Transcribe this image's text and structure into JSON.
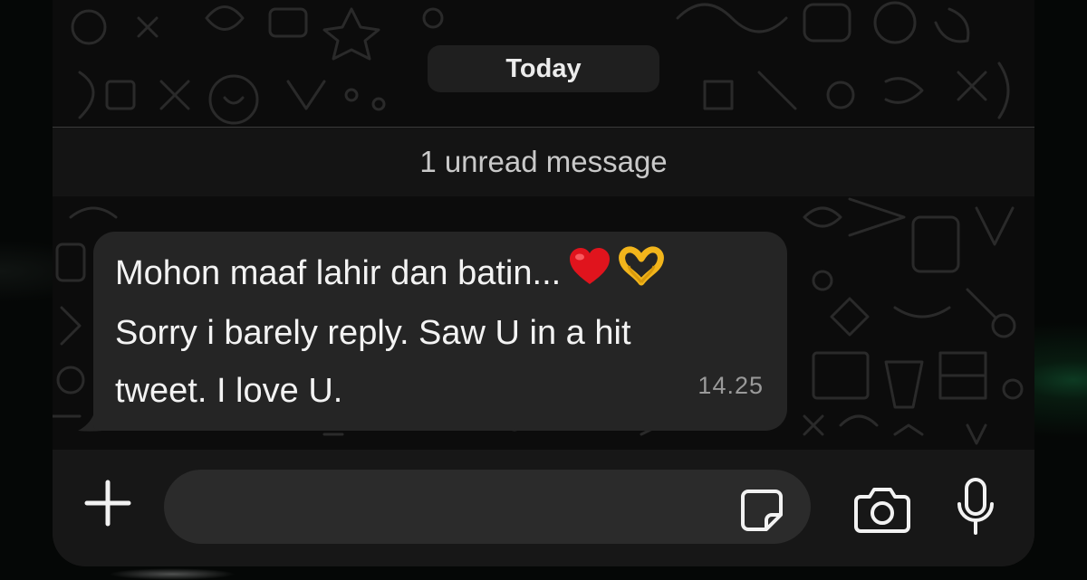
{
  "chat": {
    "date_separator": "Today",
    "unread_banner": "1 unread message",
    "messages": [
      {
        "lines": [
          "Mohon maaf lahir dan batin...",
          "Sorry i barely reply. Saw U in a hit",
          "tweet. I love U."
        ],
        "emojis": [
          "heart-emoji",
          "heart-hands-emoji"
        ],
        "time": "14.25",
        "direction": "incoming"
      }
    ]
  },
  "composer": {
    "value": "",
    "icons": {
      "attach": "plus-icon",
      "sticker": "sticker-icon",
      "camera": "camera-icon",
      "voice": "microphone-icon"
    }
  },
  "colors": {
    "bubble": "#252525",
    "wallpaper": "#0c0c0c",
    "input_bar": "#171717",
    "text": "#f3f3f3",
    "timestamp": "#9a9a9a",
    "accent_glow": "#0d3a22"
  }
}
